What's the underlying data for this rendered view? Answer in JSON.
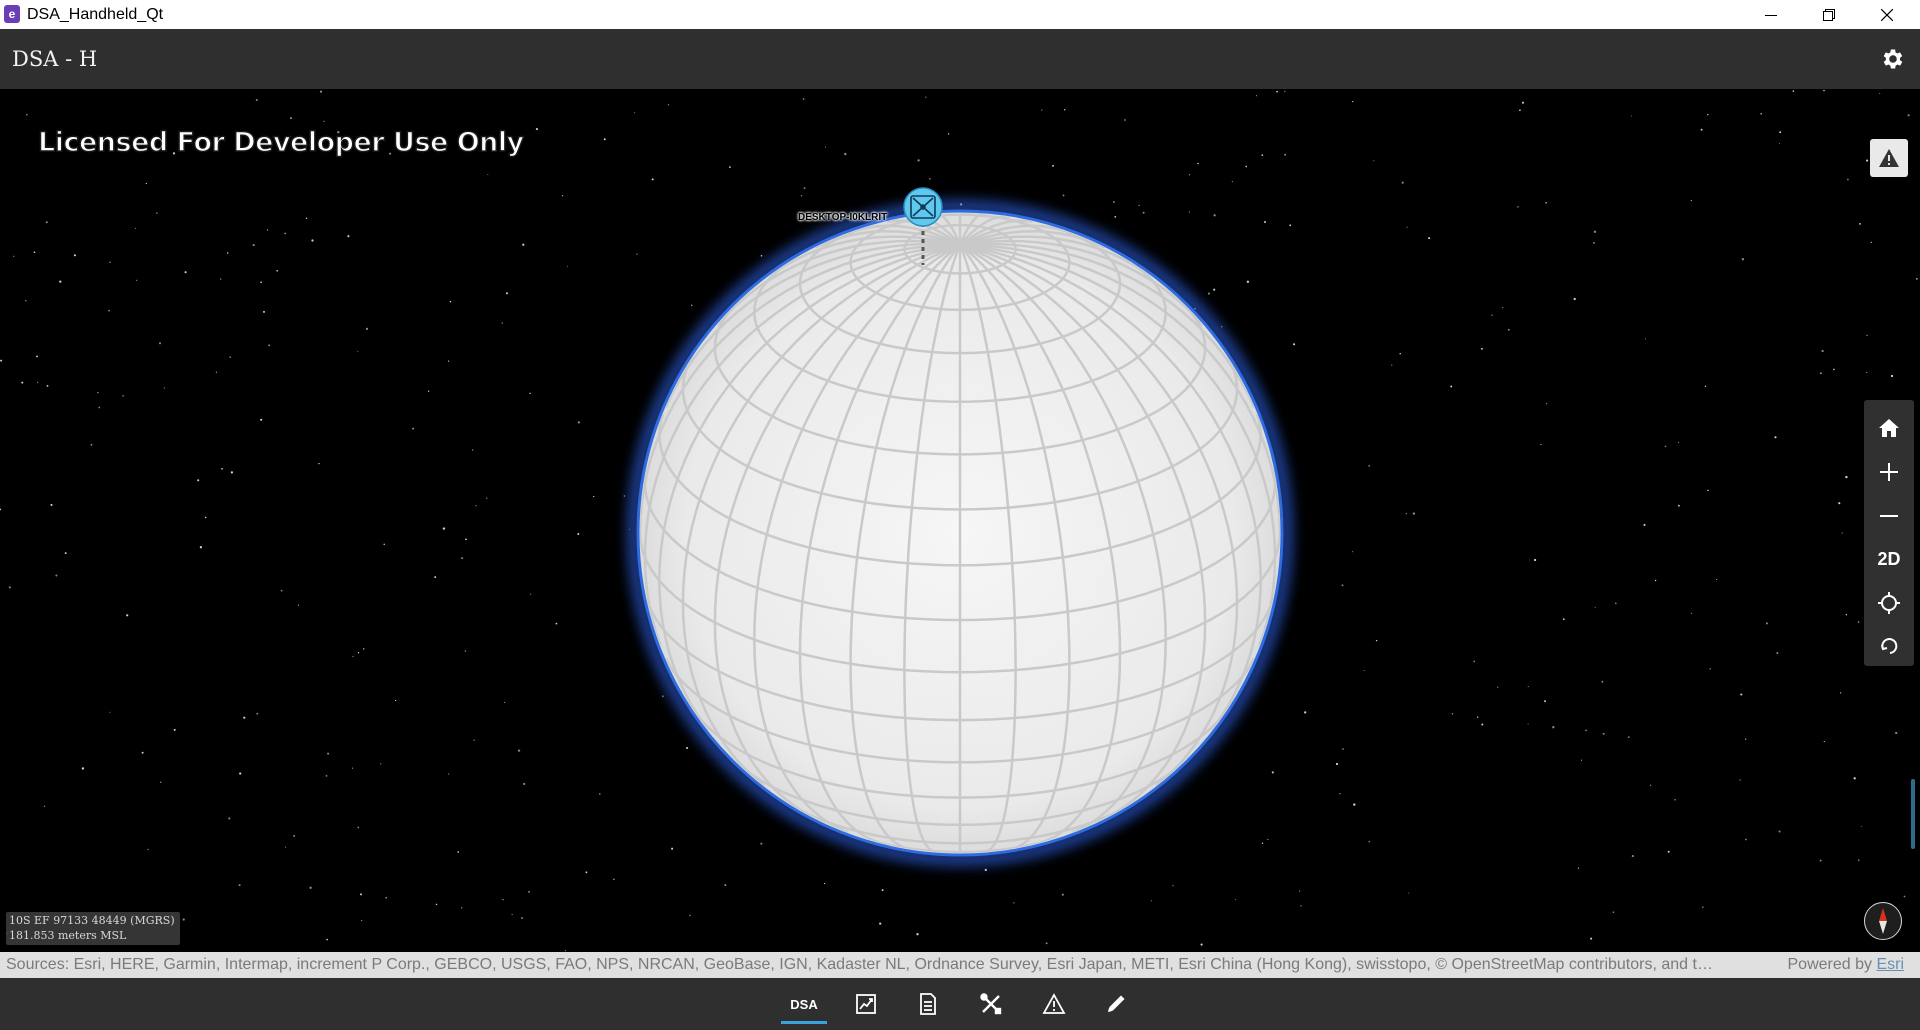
{
  "window": {
    "title": "DSA_Handheld_Qt",
    "app_icon_glyph": "e",
    "controls": [
      "minimize-icon",
      "restore-icon",
      "close-icon"
    ]
  },
  "header": {
    "title": "DSA - H",
    "settings_icon": "gear-icon"
  },
  "map": {
    "license_watermark": "Licensed For Developer Use Only",
    "device_label": "DESKTOP-I0KLRIT",
    "alert_icon": "warning-icon",
    "nav_toolbar": [
      {
        "name": "home",
        "icon": "home-icon"
      },
      {
        "name": "zoom-in",
        "icon": "plus-icon"
      },
      {
        "name": "zoom-out",
        "icon": "minus-icon"
      },
      {
        "name": "2d",
        "label": "2D"
      },
      {
        "name": "locate",
        "icon": "crosshair-icon"
      },
      {
        "name": "follow",
        "icon": "rotate-icon"
      }
    ],
    "coordinates": {
      "mgrs": "10S EF 97133 48449 (MGRS)",
      "elevation": "181.853 meters MSL"
    },
    "compass_icon": "compass-icon"
  },
  "attribution": {
    "sources": "Sources: Esri, HERE, Garmin, Intermap, increment P Corp., GEBCO, USGS, FAO, NPS, NRCAN, GeoBase, IGN, Kadaster NL, Ordnance Survey, Esri Japan, METI, Esri China (Hong Kong), swisstopo, © OpenStreetMap contributors, and t…",
    "powered_by": "Powered by ",
    "powered_by_link": "Esri"
  },
  "bottom_tabs": [
    {
      "name": "dsa",
      "label": "DSA",
      "active": true
    },
    {
      "name": "report",
      "icon": "chart-report-icon"
    },
    {
      "name": "document",
      "icon": "document-icon"
    },
    {
      "name": "tools",
      "icon": "tools-icon"
    },
    {
      "name": "alerts",
      "icon": "warning-icon"
    },
    {
      "name": "markup",
      "icon": "pencil-icon"
    }
  ],
  "colors": {
    "accent": "#38a3df",
    "header_bg": "#2f2f2f",
    "globe_glow": "#2a5bd7",
    "device_marker": "#5ec8ee"
  }
}
